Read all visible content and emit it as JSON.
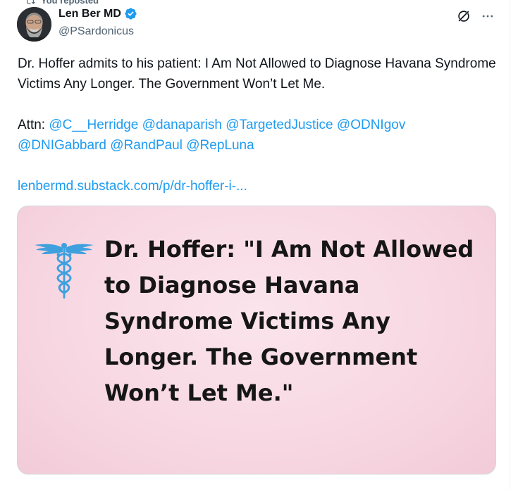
{
  "repost_header": "You reposted",
  "author": {
    "display_name": "Len Ber MD",
    "handle": "@PSardonicus"
  },
  "tweet": {
    "line1": "Dr. Hoffer admits to his patient: I Am Not Allowed to Diagnose Havana Syndrome Victims Any Longer. The Government Won’t Let Me.",
    "attn_label": "Attn:",
    "mentions": [
      "@C__Herridge",
      "@danaparish",
      "@TargetedJustice",
      "@ODNIgov",
      "@DNIGabbard",
      "@RandPaul",
      "@RepLuna"
    ],
    "link": "lenbermd.substack.com/p/dr-hoffer-i-..."
  },
  "card": {
    "headline": "Dr. Hoffer: \"I Am Not Allowed to Diagnose Havana Syndrome Victims Any Longer. The Government Won’t Let Me.\""
  },
  "colors": {
    "accent": "#1d9bf0",
    "text": "#0f1419",
    "muted": "#536471",
    "card_bg": "#f7d7e2"
  },
  "icons": {
    "repost": "repost-icon",
    "verified": "verified-badge-icon",
    "grok": "grok-icon",
    "more": "more-icon",
    "caduceus": "caduceus-icon"
  }
}
